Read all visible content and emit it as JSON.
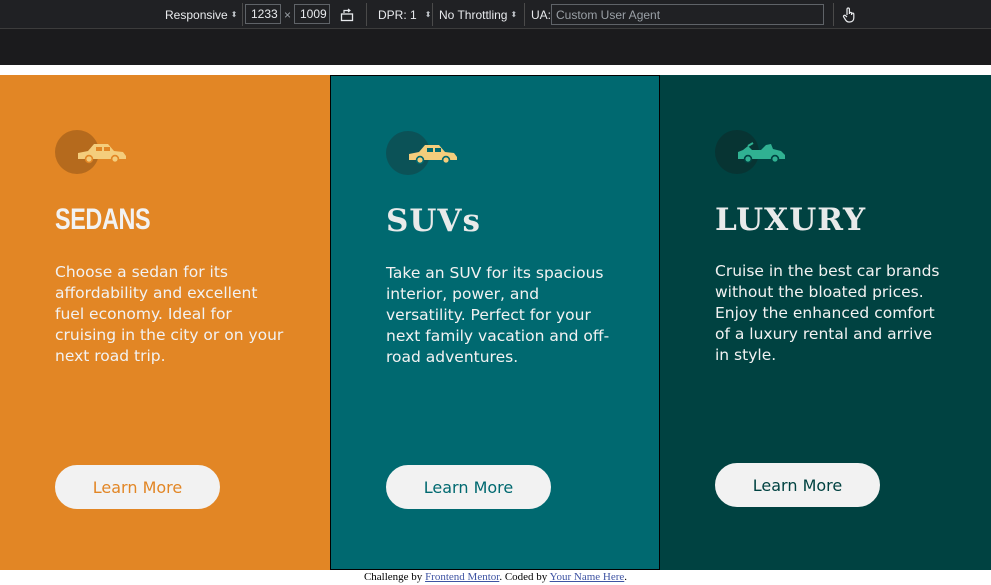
{
  "devtools": {
    "device_mode": "Responsive",
    "width": "1233",
    "times": "×",
    "height": "1009",
    "dpr_label": "DPR: 1",
    "throttling": "No Throttling",
    "ua_label": "UA:",
    "ua_placeholder": "Custom User Agent",
    "icons": [
      "rotate-icon",
      "touch-hand-icon"
    ]
  },
  "cards": [
    {
      "title": "SEDANS",
      "description": "Choose a sedan for its affordability and excellent fuel economy. Ideal for cruising in the city or on your next road trip.",
      "button_label": "Learn More",
      "icon": "sedan-car-icon",
      "background": "#e28625",
      "icon_color": "#f4cd7c"
    },
    {
      "title": "SUVs",
      "description": "Take an SUV for its spacious interior, power, and versatility. Perfect for your next family vacation and off-road adventures.",
      "button_label": "Learn More",
      "icon": "suv-car-icon",
      "background": "#006970",
      "icon_color": "#f4cd7c"
    },
    {
      "title": "LUXURY",
      "description": "Cruise in the best car brands without the bloated prices. Enjoy the enhanced comfort of a luxury rental and arrive in style.",
      "button_label": "Learn More",
      "icon": "luxury-car-icon",
      "background": "#004241",
      "icon_color": "#30b192"
    }
  ],
  "attribution": {
    "prefix": "Challenge by ",
    "link1": "Frontend Mentor",
    "middle": ". Coded by ",
    "link2": "Your Name Here",
    "suffix": "."
  }
}
